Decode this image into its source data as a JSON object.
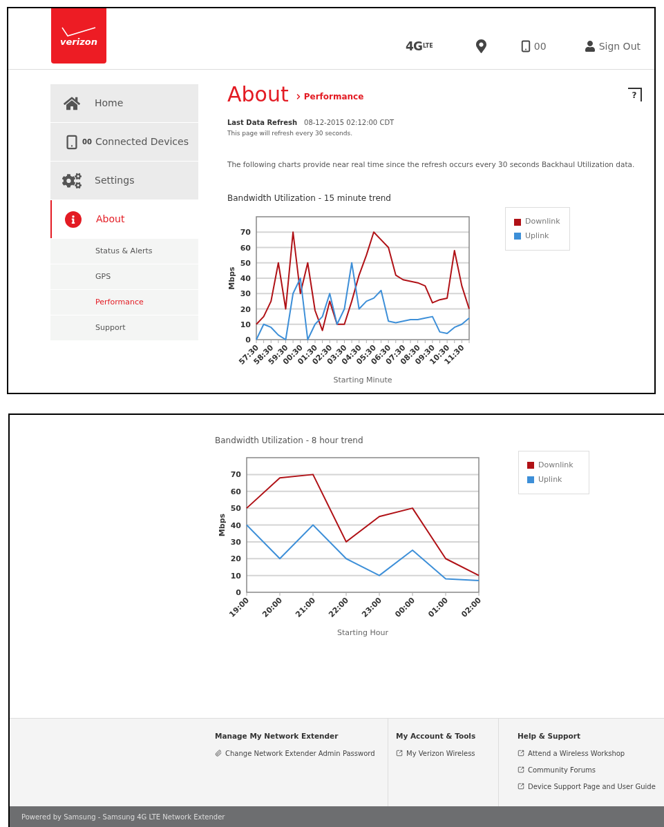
{
  "header": {
    "logo_text": "verizon",
    "network": {
      "main": "4G",
      "sub": "LTE"
    },
    "devices_count": "00",
    "sign_out": "Sign Out"
  },
  "sidebar": {
    "items": [
      {
        "kind": "home",
        "label": "Home",
        "selected": false
      },
      {
        "kind": "devices",
        "label": "Connected Devices",
        "badge": "00",
        "selected": false
      },
      {
        "kind": "settings",
        "label": "Settings",
        "selected": false
      },
      {
        "kind": "about",
        "label": "About",
        "selected": true
      }
    ],
    "subitems": [
      {
        "label": "Status & Alerts",
        "selected": false
      },
      {
        "label": "GPS",
        "selected": false
      },
      {
        "label": "Performance",
        "selected": true
      },
      {
        "label": "Support",
        "selected": false
      }
    ]
  },
  "page": {
    "help": "?",
    "title": "About",
    "breadcrumb": "Performance",
    "refresh_label": "Last Data Refresh",
    "refresh_value": "08-12-2015 02:12:00 CDT",
    "refresh_note": "This page will refresh every 30 seconds.",
    "description": "The following charts provide near real time since the refresh occurs every 30 seconds Backhaul Utilization data."
  },
  "charts": [
    {
      "title": "Bandwidth Utilization - 15 minute trend",
      "chart_data": {
        "type": "line",
        "xlabel": "Starting Minute",
        "ylabel": "Mbps",
        "categories": [
          "57:30",
          null,
          "58:30",
          null,
          "59:30",
          null,
          "00:30",
          null,
          "01:30",
          null,
          "02:30",
          null,
          "03:30",
          null,
          "04:30",
          null,
          "05:30",
          null,
          "06:30",
          null,
          "07:30",
          null,
          "08:30",
          null,
          "09:30",
          null,
          "10:30",
          null,
          "11:30",
          null
        ],
        "grid": true,
        "series": [
          {
            "name": "Downlink",
            "color": "#b01116",
            "values": [
              10,
              15,
              25,
              50,
              20,
              70,
              30,
              50,
              19,
              6,
              25,
              10,
              10,
              25,
              42,
              55,
              70,
              65,
              60,
              42,
              39,
              38,
              37,
              35,
              24,
              26,
              27,
              58,
              35,
              20
            ]
          },
          {
            "name": "Uplink",
            "color": "#3d8fd8",
            "values": [
              0,
              10,
              8,
              3,
              0,
              30,
              40,
              0,
              10,
              15,
              30,
              10,
              20,
              50,
              20,
              25,
              27,
              32,
              12,
              11,
              12,
              13,
              13,
              14,
              15,
              5,
              4,
              8,
              10,
              14
            ]
          }
        ],
        "ylim": [
          0,
          80
        ],
        "yticks": [
          0,
          10,
          20,
          30,
          40,
          50,
          60,
          70
        ]
      }
    },
    {
      "title": "Bandwidth Utilization - 8 hour trend",
      "chart_data": {
        "type": "line",
        "xlabel": "Starting Hour",
        "ylabel": "Mbps",
        "categories": [
          "19:00",
          "20:00",
          "21:00",
          "22:00",
          "23:00",
          "00:00",
          "01:00",
          "02:00"
        ],
        "grid": true,
        "series": [
          {
            "name": "Downlink",
            "color": "#b01116",
            "values": [
              50,
              68,
              70,
              30,
              45,
              50,
              20,
              10
            ]
          },
          {
            "name": "Uplink",
            "color": "#3d8fd8",
            "values": [
              40,
              20,
              40,
              20,
              10,
              25,
              8,
              7
            ]
          }
        ],
        "ylim": [
          0,
          80
        ],
        "yticks": [
          0,
          10,
          20,
          30,
          40,
          50,
          60,
          70
        ]
      }
    }
  ],
  "footer": {
    "columns": [
      {
        "title": "Manage My Network Extender",
        "links": [
          {
            "kind": "clip",
            "label": "Change Network Extender Admin Password"
          }
        ]
      },
      {
        "title": "My Account & Tools",
        "links": [
          {
            "kind": "external",
            "label": "My Verizon Wireless"
          }
        ]
      },
      {
        "title": "Help & Support",
        "links": [
          {
            "kind": "external",
            "label": "Attend a Wireless Workshop"
          },
          {
            "kind": "external",
            "label": "Community Forums"
          },
          {
            "kind": "external",
            "label": "Device Support Page and User Guide"
          }
        ]
      }
    ],
    "powered_by": "Powered by Samsung - Samsung 4G LTE Network Extender"
  }
}
